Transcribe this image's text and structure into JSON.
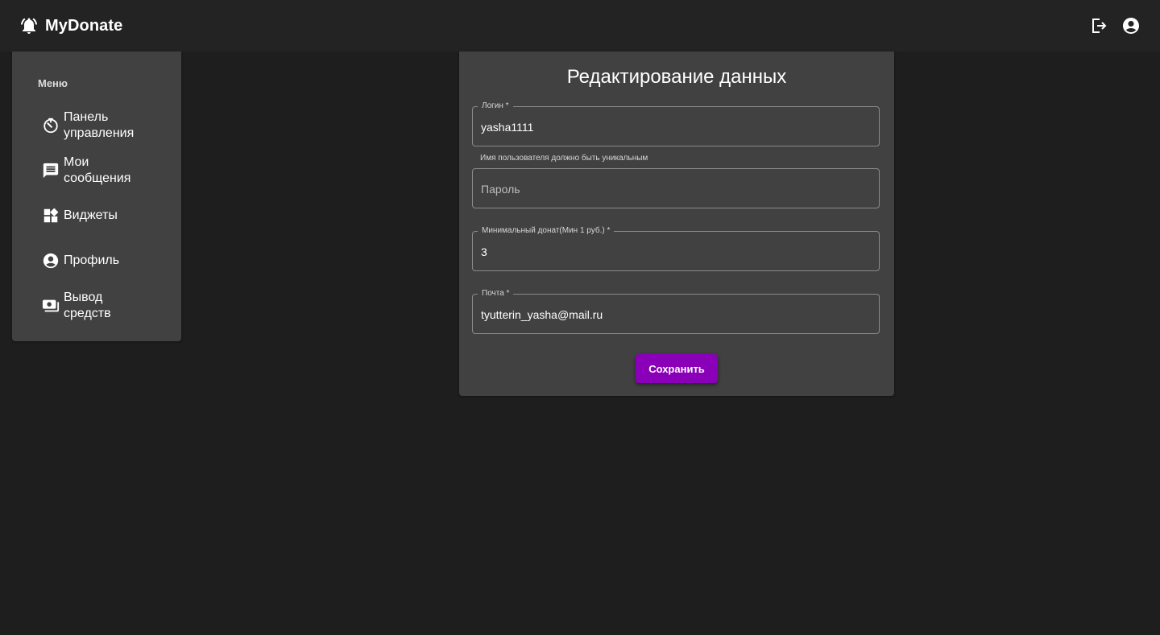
{
  "header": {
    "title": "MyDonate",
    "logo_icon": "notification-bell-icon",
    "actions": [
      {
        "name": "logout",
        "icon": "logout-icon"
      },
      {
        "name": "account",
        "icon": "account-circle-icon"
      }
    ]
  },
  "sidebar": {
    "heading": "Меню",
    "items": [
      {
        "label": "Панель\nуправления",
        "icon": "dashboard-timer-icon"
      },
      {
        "label": "Мои\nсообщения",
        "icon": "message-icon"
      },
      {
        "label": "Виджеты",
        "icon": "widgets-icon"
      },
      {
        "label": "Профиль",
        "icon": "account-circle-icon"
      },
      {
        "label": "Вывод\nсредств",
        "icon": "payments-icon"
      }
    ]
  },
  "form": {
    "title": "Редактирование данных",
    "login": {
      "label": "Логин *",
      "value": "yasha1111",
      "helper": "Имя пользователя должно быть уникальным"
    },
    "password": {
      "placeholder": "Пароль",
      "value": ""
    },
    "min_donate": {
      "label": "Минимальный донат(Мин 1 руб.) *",
      "value": "3"
    },
    "email": {
      "label": "Почта *",
      "value": "tyutterin_yasha@mail.ru"
    },
    "save_label": "Сохранить"
  },
  "colors": {
    "background": "#1e1e1e",
    "topbar": "#232323",
    "panel": "#414141",
    "accent": "#8a00b8"
  }
}
